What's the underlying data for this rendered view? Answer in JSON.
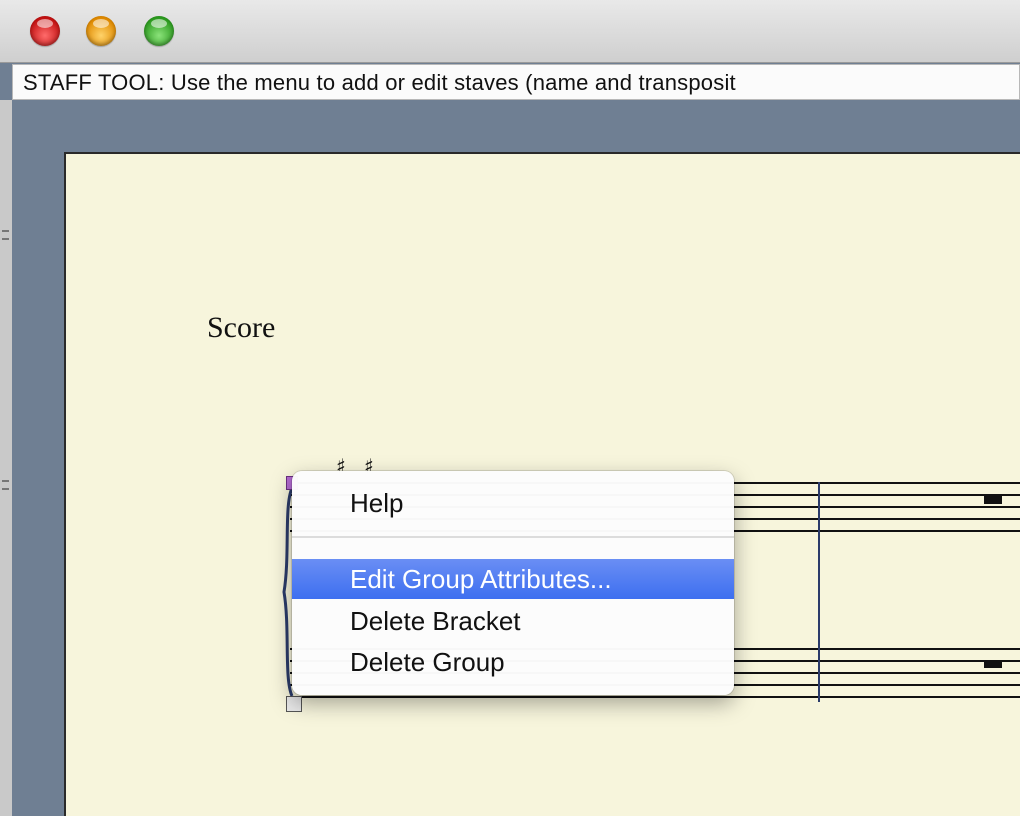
{
  "window": {
    "status_text": "STAFF TOOL: Use the menu to add or edit staves (name and transposit"
  },
  "score": {
    "title": "Score",
    "key_signature": "♯ ♯"
  },
  "context_menu": {
    "items": [
      {
        "label": "Help"
      },
      {
        "label": "Edit Group Attributes..."
      },
      {
        "label": "Delete Bracket"
      },
      {
        "label": "Delete Group"
      }
    ],
    "highlight_color": "#3d6ff0"
  },
  "colors": {
    "paper": "#f7f5dc",
    "desktop": "#6f7f93",
    "bracket_handle": "#b36ad1"
  }
}
